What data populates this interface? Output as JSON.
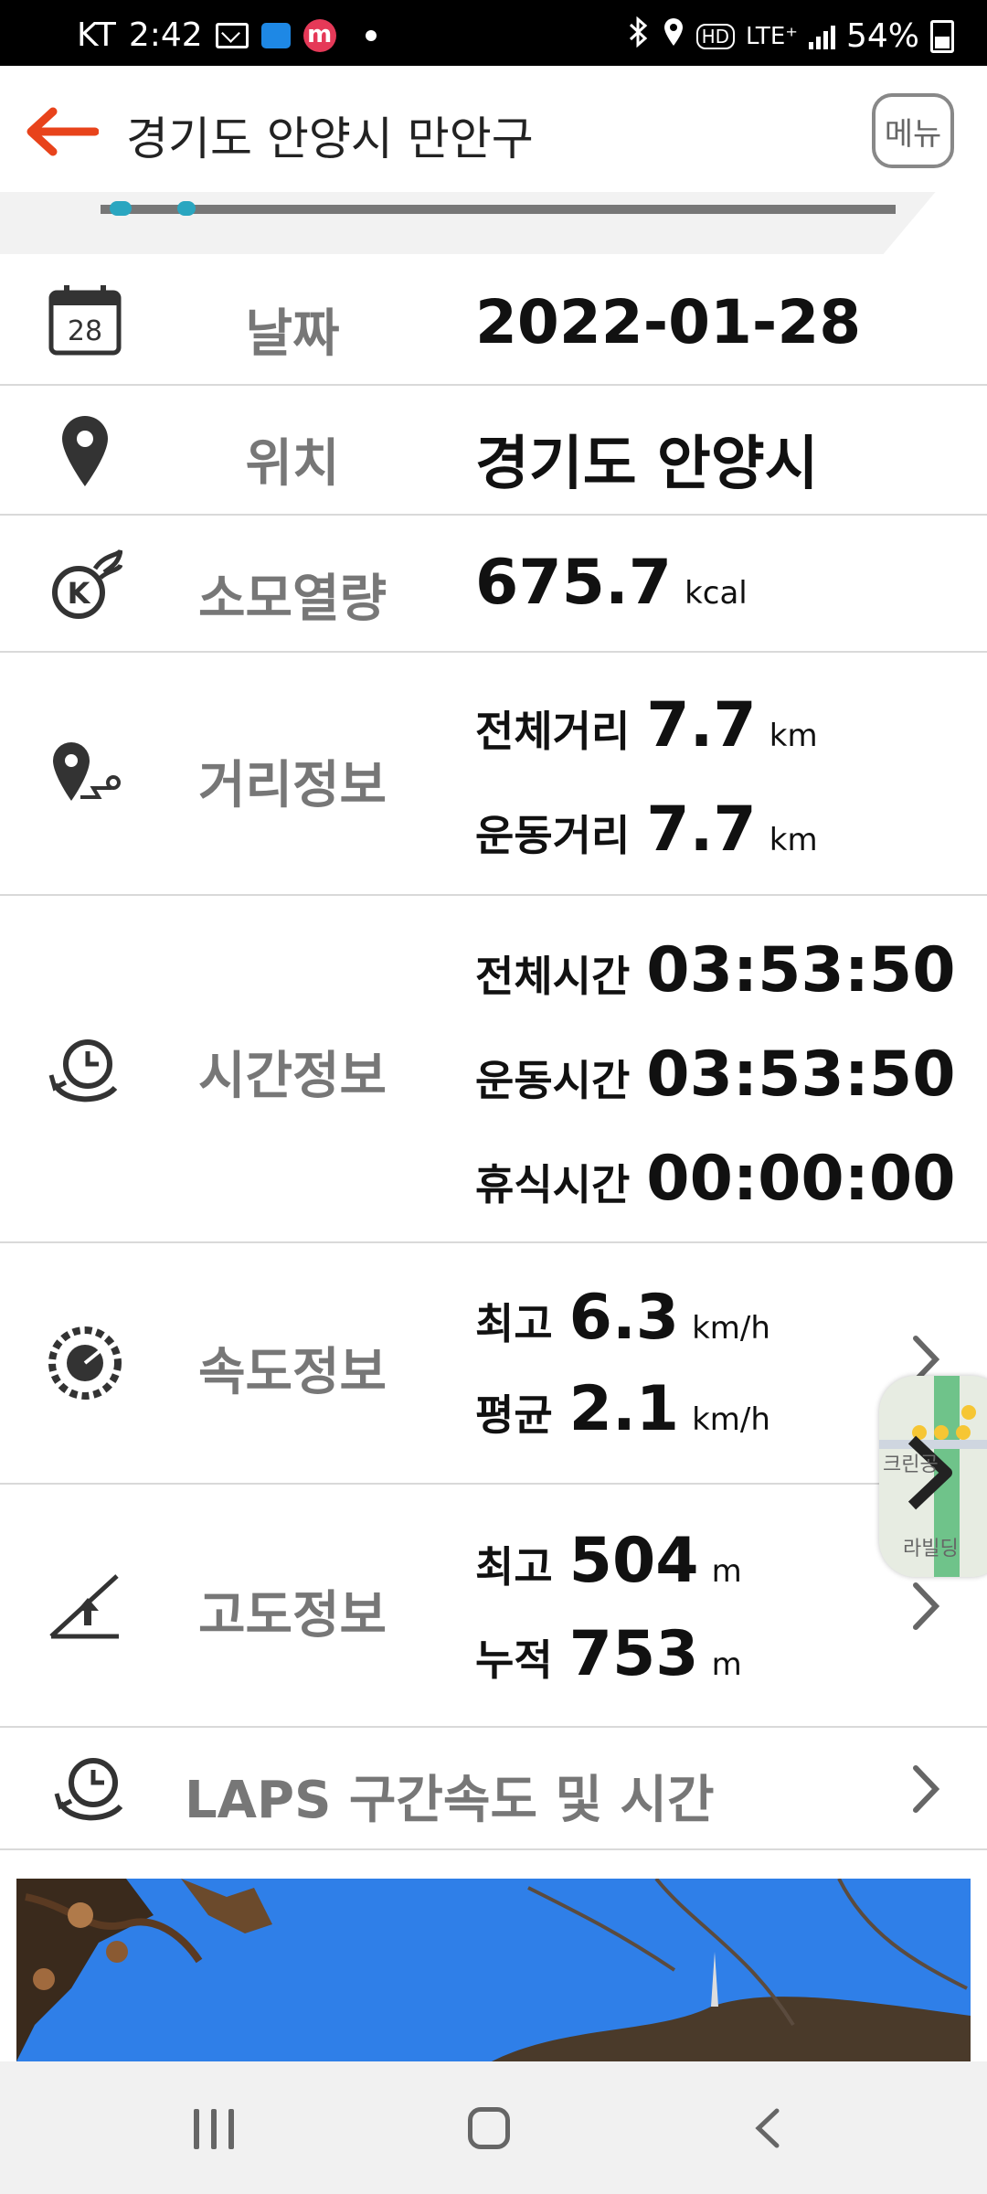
{
  "status_bar": {
    "carrier": "KT",
    "time": "2:42",
    "network": "LTE⁺",
    "battery": "54%"
  },
  "header": {
    "title": "경기도 안양시 만안구",
    "menu_label": "메뉴"
  },
  "rows": {
    "date": {
      "label": "날짜",
      "value": "2022-01-28",
      "calendar_day": "28"
    },
    "location": {
      "label": "위치",
      "value": "경기도 안양시"
    },
    "calories": {
      "label": "소모열량",
      "value": "675.7",
      "unit": "kcal"
    },
    "distance": {
      "label": "거리정보",
      "total_label": "전체거리",
      "total_value": "7.7",
      "total_unit": "km",
      "moving_label": "운동거리",
      "moving_value": "7.7",
      "moving_unit": "km"
    },
    "time": {
      "label": "시간정보",
      "total_label": "전체시간",
      "total_value": "03:53:50",
      "moving_label": "운동시간",
      "moving_value": "03:53:50",
      "rest_label": "휴식시간",
      "rest_value": "00:00:00"
    },
    "speed": {
      "label": "속도정보",
      "max_label": "최고",
      "max_value": "6.3",
      "max_unit": "km/h",
      "avg_label": "평균",
      "avg_value": "2.1",
      "avg_unit": "km/h"
    },
    "altitude": {
      "label": "고도정보",
      "max_label": "최고",
      "max_value": "504",
      "max_unit": "m",
      "cum_label": "누적",
      "cum_value": "753",
      "cum_unit": "m"
    },
    "laps": {
      "label": "LAPS 구간속도 및 시간"
    }
  },
  "map_thumbnail": {
    "text_1": "크린공",
    "text_2": "라빌딩"
  },
  "colors": {
    "accent": "#e8431b",
    "label_gray": "#777777",
    "divider": "#d9d9d9"
  },
  "icons": [
    "back-arrow-icon",
    "calendar-icon",
    "location-pin-icon",
    "calorie-flame-icon",
    "route-pin-icon",
    "clock-rewind-icon",
    "speedometer-icon",
    "altitude-slope-icon",
    "chevron-right-icon"
  ]
}
